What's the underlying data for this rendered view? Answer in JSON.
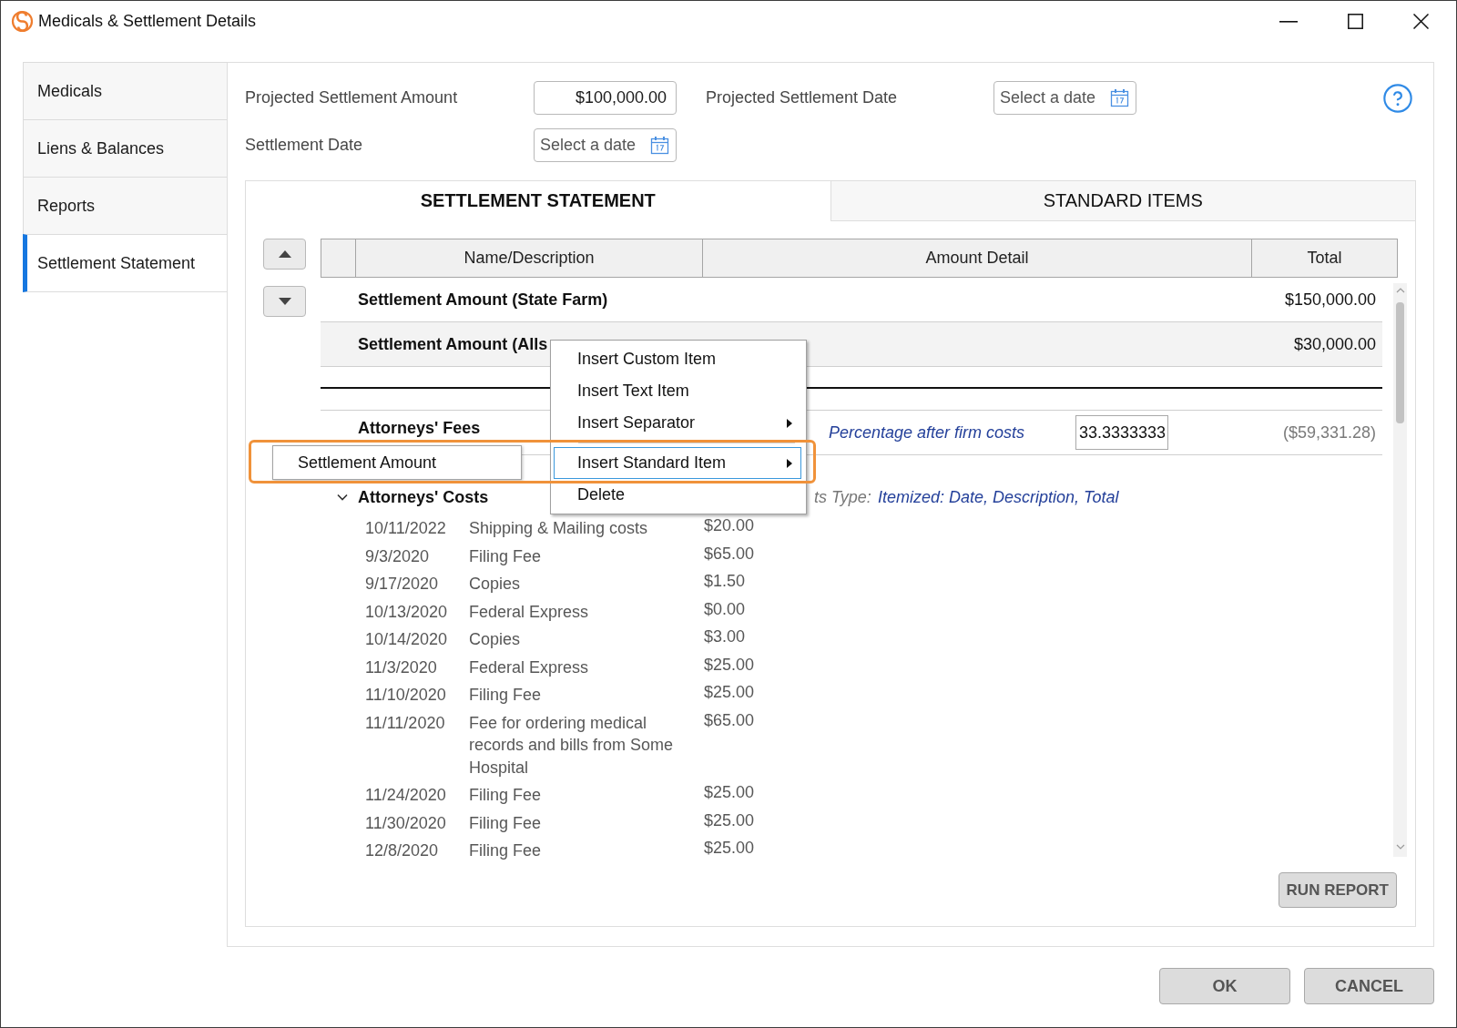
{
  "window": {
    "title": "Medicals & Settlement Details"
  },
  "sidebar": {
    "items": [
      {
        "label": "Medicals",
        "selected": false
      },
      {
        "label": "Liens & Balances",
        "selected": false
      },
      {
        "label": "Reports",
        "selected": false
      },
      {
        "label": "Settlement Statement",
        "selected": true
      }
    ]
  },
  "form": {
    "rows": [
      {
        "fields": [
          {
            "kind": "amount",
            "label": "Projected Settlement Amount",
            "value": "$100,000.00"
          },
          {
            "kind": "date",
            "label": "Projected Settlement Date",
            "placeholder": "Select a date"
          }
        ]
      },
      {
        "fields": [
          {
            "kind": "date",
            "label": "Settlement Date",
            "placeholder": "Select a date"
          }
        ]
      }
    ]
  },
  "tabs": [
    {
      "label": "SETTLEMENT STATEMENT",
      "selected": true
    },
    {
      "label": "STANDARD ITEMS",
      "selected": false
    }
  ],
  "table": {
    "columns": [
      "Name/Description",
      "Amount Detail",
      "Total"
    ],
    "rows": [
      {
        "kind": "item",
        "selected": false,
        "name": "Settlement Amount (State Farm)",
        "total": "$150,000.00"
      },
      {
        "kind": "item",
        "selected": true,
        "name": "Settlement Amount (Alls",
        "total": "$30,000.00"
      },
      {
        "kind": "separator",
        "selected": false
      },
      {
        "kind": "fee",
        "selected": false,
        "name": "Attorneys' Fees",
        "basis": "Percentage after firm costs",
        "percentage": "33.3333333",
        "total": "($59,331.28)"
      },
      {
        "kind": "costs",
        "selected": false,
        "expanded": true,
        "name": "Attorneys' Costs",
        "type_label": "ts Type:",
        "type_value": "Itemized: Date, Description, Total",
        "entries": [
          {
            "date": "10/11/2022",
            "description": "Shipping & Mailing costs",
            "amount": "$20.00"
          },
          {
            "date": "9/3/2020",
            "description": "Filing Fee",
            "amount": "$65.00"
          },
          {
            "date": "9/17/2020",
            "description": "Copies",
            "amount": "$1.50"
          },
          {
            "date": "10/13/2020",
            "description": "Federal Express",
            "amount": "$0.00"
          },
          {
            "date": "10/14/2020",
            "description": "Copies",
            "amount": "$3.00"
          },
          {
            "date": "11/3/2020",
            "description": "Federal Express",
            "amount": "$25.00"
          },
          {
            "date": "11/10/2020",
            "description": "Filing Fee",
            "amount": "$25.00"
          },
          {
            "date": "11/11/2020",
            "description": "Fee for ordering medical records and bills from Some Hospital",
            "amount": "$65.00"
          },
          {
            "date": "11/24/2020",
            "description": "Filing Fee",
            "amount": "$25.00"
          },
          {
            "date": "11/30/2020",
            "description": "Filing Fee",
            "amount": "$25.00"
          },
          {
            "date": "12/8/2020",
            "description": "Filing Fee",
            "amount": "$25.00"
          }
        ]
      }
    ]
  },
  "context_menu": {
    "items": [
      {
        "kind": "item",
        "label": "Insert Custom Item",
        "submenu": false,
        "selected": false,
        "outlined": false
      },
      {
        "kind": "item",
        "label": "Insert Text Item",
        "submenu": false,
        "selected": false,
        "outlined": false
      },
      {
        "kind": "item",
        "label": "Insert Separator",
        "submenu": true,
        "selected": false,
        "outlined": false
      },
      {
        "kind": "divider"
      },
      {
        "kind": "item",
        "label": "Insert Standard Item",
        "submenu": true,
        "selected": true,
        "outlined": true
      },
      {
        "kind": "item",
        "label": "Delete",
        "submenu": false,
        "selected": false,
        "outlined": false
      }
    ]
  },
  "submenu": {
    "items": [
      {
        "label": "Settlement Amount",
        "selected": false
      }
    ]
  },
  "run_report": "RUN REPORT",
  "dialog_buttons": [
    {
      "kind": "ok",
      "label": "OK"
    },
    {
      "kind": "cancel",
      "label": "CANCEL"
    }
  ]
}
